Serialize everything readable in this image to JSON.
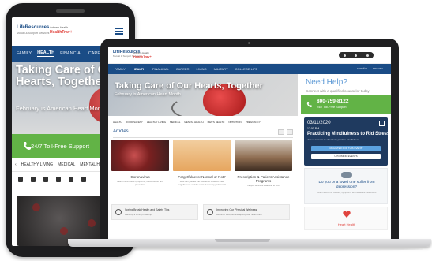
{
  "phone": {
    "logo_main": "LifeResources",
    "logo_sub": "Mutual & Support Services",
    "logo_partner_a": "Anthem Health",
    "logo_partner_b": "HealthTrav+",
    "nav": [
      "FAMILY",
      "HEALTH",
      "FINANCIAL",
      "CAREER"
    ],
    "hero_title": "Taking Care of Our Hearts, Together",
    "hero_subtitle": "February is American Heart Month",
    "support_label": "24/7 Toll-Free Support",
    "categories": [
      "HEALTHY LIVING",
      "MEDICAL",
      "MENTAL HEALTH"
    ]
  },
  "laptop": {
    "logo_main": "LifeResources",
    "logo_sub": "Mutual & Support Services",
    "logo_partner_a": "Anthem Health",
    "logo_partner_b": "HealthTrav+",
    "nav": [
      "FAMILY",
      "HEALTH",
      "FINANCIAL",
      "CAREER",
      "LIVING",
      "MILITARY",
      "COLLEGE LIFE"
    ],
    "nav_right": [
      "ESPAÑOL",
      "SPANISH"
    ],
    "hero_title": "Taking Care of Our Hearts, Together",
    "hero_subtitle": "February is American Heart Month",
    "categories": [
      "HEALTH",
      "FOOD SAFETY",
      "HEALTHY LIVING",
      "MEDICAL",
      "MENTAL HEALTH",
      "MEN'S HEALTH",
      "NUTRITION",
      "PREGNANCY"
    ],
    "articles_label": "Articles",
    "cards": [
      {
        "title": "Coronavirus",
        "desc": "Learn more about symptoms, transmission and prevention"
      },
      {
        "title": "Forgetfulness: Normal or Not?",
        "desc": "How can you tell the difference between mild forgetfulness and the start of memory problems?"
      },
      {
        "title": "Prescription & Patient Assistance Programs",
        "desc": "Helpful services available to you"
      }
    ],
    "tips": [
      {
        "title": "Spring Break Health and Safety Tips",
        "desc": "Planning a spring break trip"
      },
      {
        "title": "Improving Our Physical Wellness",
        "desc": "Healthier lifestyles and appropriate health care"
      }
    ],
    "help_title": "Need Help?",
    "help_sub": "Connect with a qualified counselor today",
    "phone_number": "800-759-8122",
    "support_label": "24/7 Toll-Free Support",
    "event_date": "03/11/2020",
    "event_time": "12:00 PM",
    "event_title": "Practicing Mindfulness to Rid Stress",
    "event_desc": "Join us to learn to effectively practice mindfulness",
    "event_btn_register": "REGISTER FOR THIS EVENT",
    "event_btn_upcoming": "UPCOMING EVENTS",
    "dep_title": "Do you or a loved one suffer from depression?",
    "dep_desc": "Learn about the causes, symptoms and available treatments",
    "heart_label": "Heart Health"
  },
  "colors": {
    "brand_blue": "#1a4c86",
    "green": "#62b346",
    "light_blue": "#5e9ad6",
    "event_bg": "#1f3a5f",
    "red": "#e0443e"
  }
}
